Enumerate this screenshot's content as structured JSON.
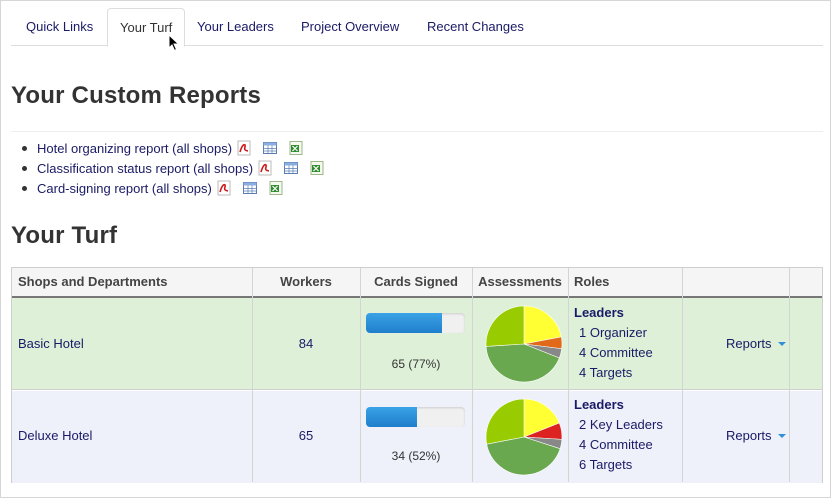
{
  "tabs": [
    {
      "label": "Quick Links",
      "active": false
    },
    {
      "label": "Your Turf",
      "active": true
    },
    {
      "label": "Your Leaders",
      "active": false
    },
    {
      "label": "Project Overview",
      "active": false
    },
    {
      "label": "Recent Changes",
      "active": false
    }
  ],
  "custom_reports": {
    "title": "Your Custom Reports",
    "items": [
      {
        "label": "Hotel organizing report (all shops)",
        "formats": [
          "pdf-icon",
          "table-icon",
          "excel-icon"
        ]
      },
      {
        "label": "Classification status report (all shops)",
        "formats": [
          "pdf-icon",
          "table-icon",
          "excel-icon"
        ]
      },
      {
        "label": "Card-signing report (all shops)",
        "formats": [
          "pdf-icon",
          "table-icon",
          "excel-icon"
        ]
      }
    ]
  },
  "turf": {
    "title": "Your Turf",
    "columns": [
      "Shops and Departments",
      "Workers",
      "Cards Signed",
      "Assessments",
      "Roles"
    ],
    "rows": [
      {
        "name": "Basic Hotel",
        "workers": "84",
        "cards_fraction": 0.77,
        "cards_text": "65 (77%)",
        "roles_head": "Leaders",
        "roles": [
          "1 Organizer",
          "4 Committee",
          "4 Targets"
        ],
        "reports_label": "Reports",
        "assessments": [
          {
            "value": 0.22,
            "color": "#ffff33"
          },
          {
            "value": 0.05,
            "color": "#e06a1a"
          },
          {
            "value": 0.04,
            "color": "#888888"
          },
          {
            "value": 0.43,
            "color": "#6aa84f"
          },
          {
            "value": 0.26,
            "color": "#99cc00"
          }
        ]
      },
      {
        "name": "Deluxe Hotel",
        "workers": "65",
        "cards_fraction": 0.52,
        "cards_text": "34 (52%)",
        "roles_head": "Leaders",
        "roles": [
          "2 Key Leaders",
          "4 Committee",
          "6 Targets"
        ],
        "reports_label": "Reports",
        "assessments": [
          {
            "value": 0.19,
            "color": "#ffff33"
          },
          {
            "value": 0.07,
            "color": "#dd2222"
          },
          {
            "value": 0.04,
            "color": "#888888"
          },
          {
            "value": 0.42,
            "color": "#6aa84f"
          },
          {
            "value": 0.28,
            "color": "#99cc00"
          }
        ]
      }
    ]
  },
  "colors": {
    "link": "#1a1a66",
    "progress": "#1f7ecb",
    "row_green": "#dff0d8",
    "row_blue": "#eef0fa"
  }
}
